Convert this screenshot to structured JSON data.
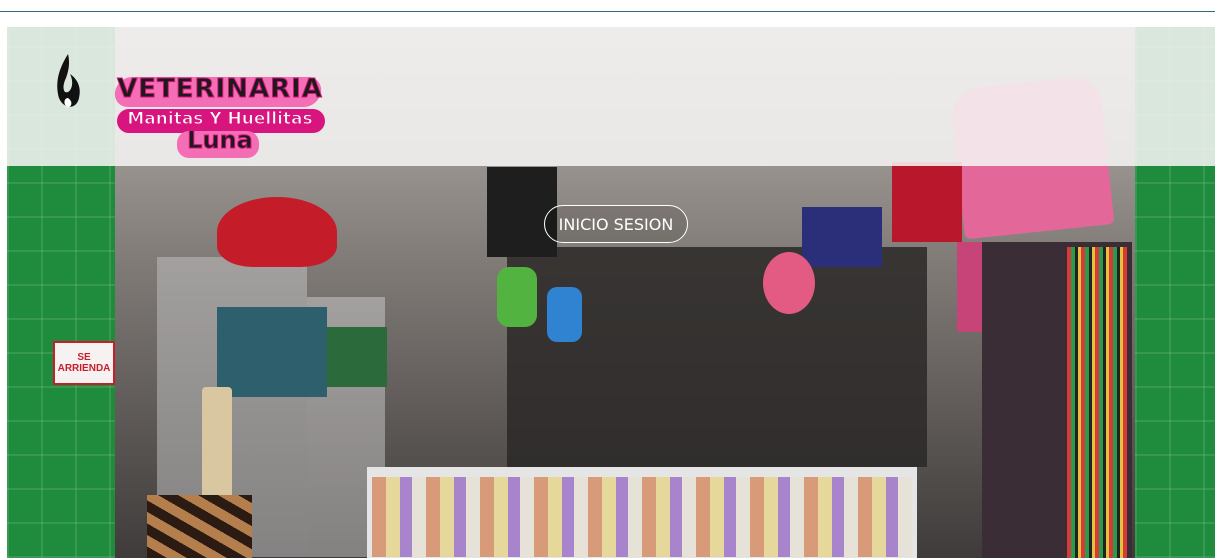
{
  "brand": {
    "logo_line1": "VETERINARIA",
    "logo_line2": "Manitas Y Huellitas",
    "logo_line3": "Luna",
    "icon": "pet-flame-logo-icon",
    "accent": "#d8157e"
  },
  "nav": {
    "login_label": "INICIO SESION"
  },
  "hero": {
    "sign_text": "SE ARRIENDA"
  }
}
